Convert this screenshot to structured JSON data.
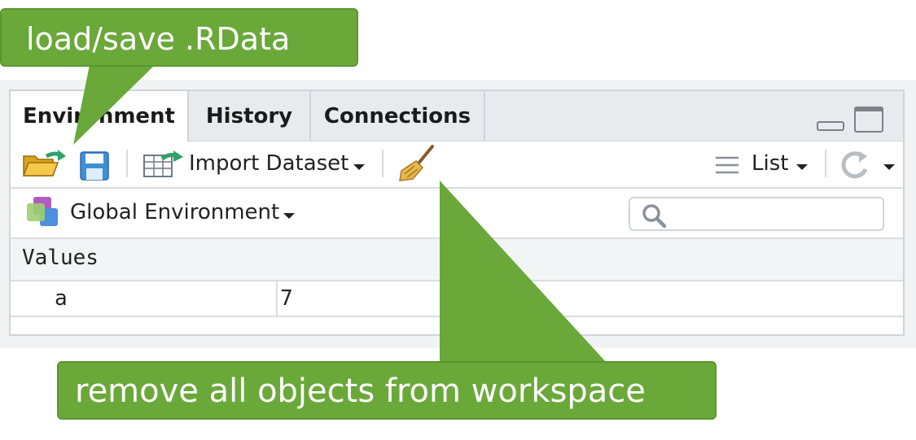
{
  "tabs": [
    {
      "label": "Environment",
      "active": true
    },
    {
      "label": "History",
      "active": false
    },
    {
      "label": "Connections",
      "active": false
    }
  ],
  "toolbar": {
    "import_label": "Import Dataset",
    "view_label": "List"
  },
  "env_selector": {
    "label": "Global Environment"
  },
  "search": {
    "placeholder": ""
  },
  "section": {
    "label": "Values"
  },
  "rows": [
    {
      "name": "a",
      "value": "7"
    }
  ],
  "callouts": {
    "top": "load/save .RData",
    "bottom": "remove all objects from workspace"
  },
  "colors": {
    "callout_green": "#6aa83a",
    "tab_bg": "#e8ebee",
    "border": "#cfd4d9"
  },
  "icons": [
    "open-folder-icon",
    "save-icon",
    "import-dataset-icon",
    "broom-icon",
    "list-icon",
    "refresh-icon",
    "search-icon",
    "environment-icon",
    "minimize-icon",
    "maximize-icon"
  ]
}
